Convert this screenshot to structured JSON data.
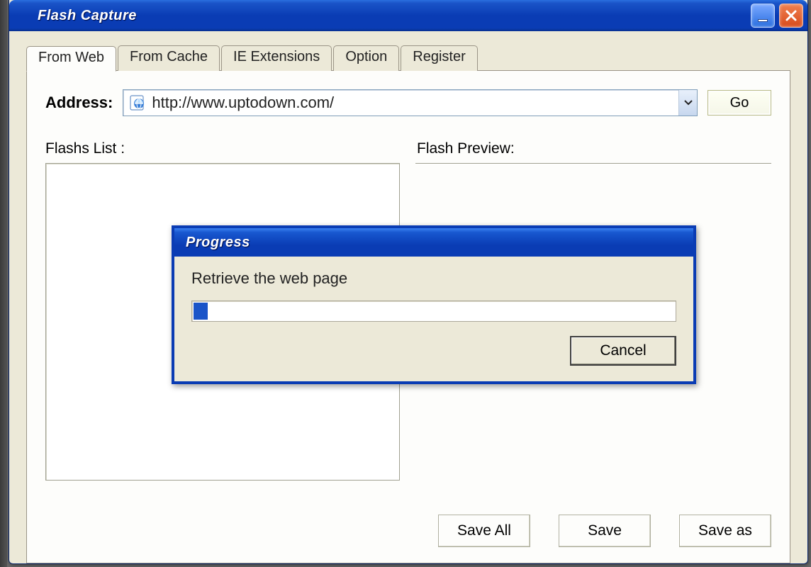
{
  "window": {
    "title": "Flash Capture"
  },
  "tabs": [
    {
      "label": "From Web",
      "active": true
    },
    {
      "label": "From Cache",
      "active": false
    },
    {
      "label": "IE Extensions",
      "active": false
    },
    {
      "label": "Option",
      "active": false
    },
    {
      "label": "Register",
      "active": false
    }
  ],
  "address": {
    "label": "Address:",
    "value": "http://www.uptodown.com/",
    "go_label": "Go"
  },
  "flashs_list_label": "Flashs List :",
  "flash_preview_label": "Flash Preview:",
  "buttons": {
    "save_all": "Save All",
    "save": "Save",
    "save_as": "Save as"
  },
  "progress_dialog": {
    "title": "Progress",
    "message": "Retrieve the web page",
    "percent": 3,
    "cancel_label": "Cancel"
  }
}
